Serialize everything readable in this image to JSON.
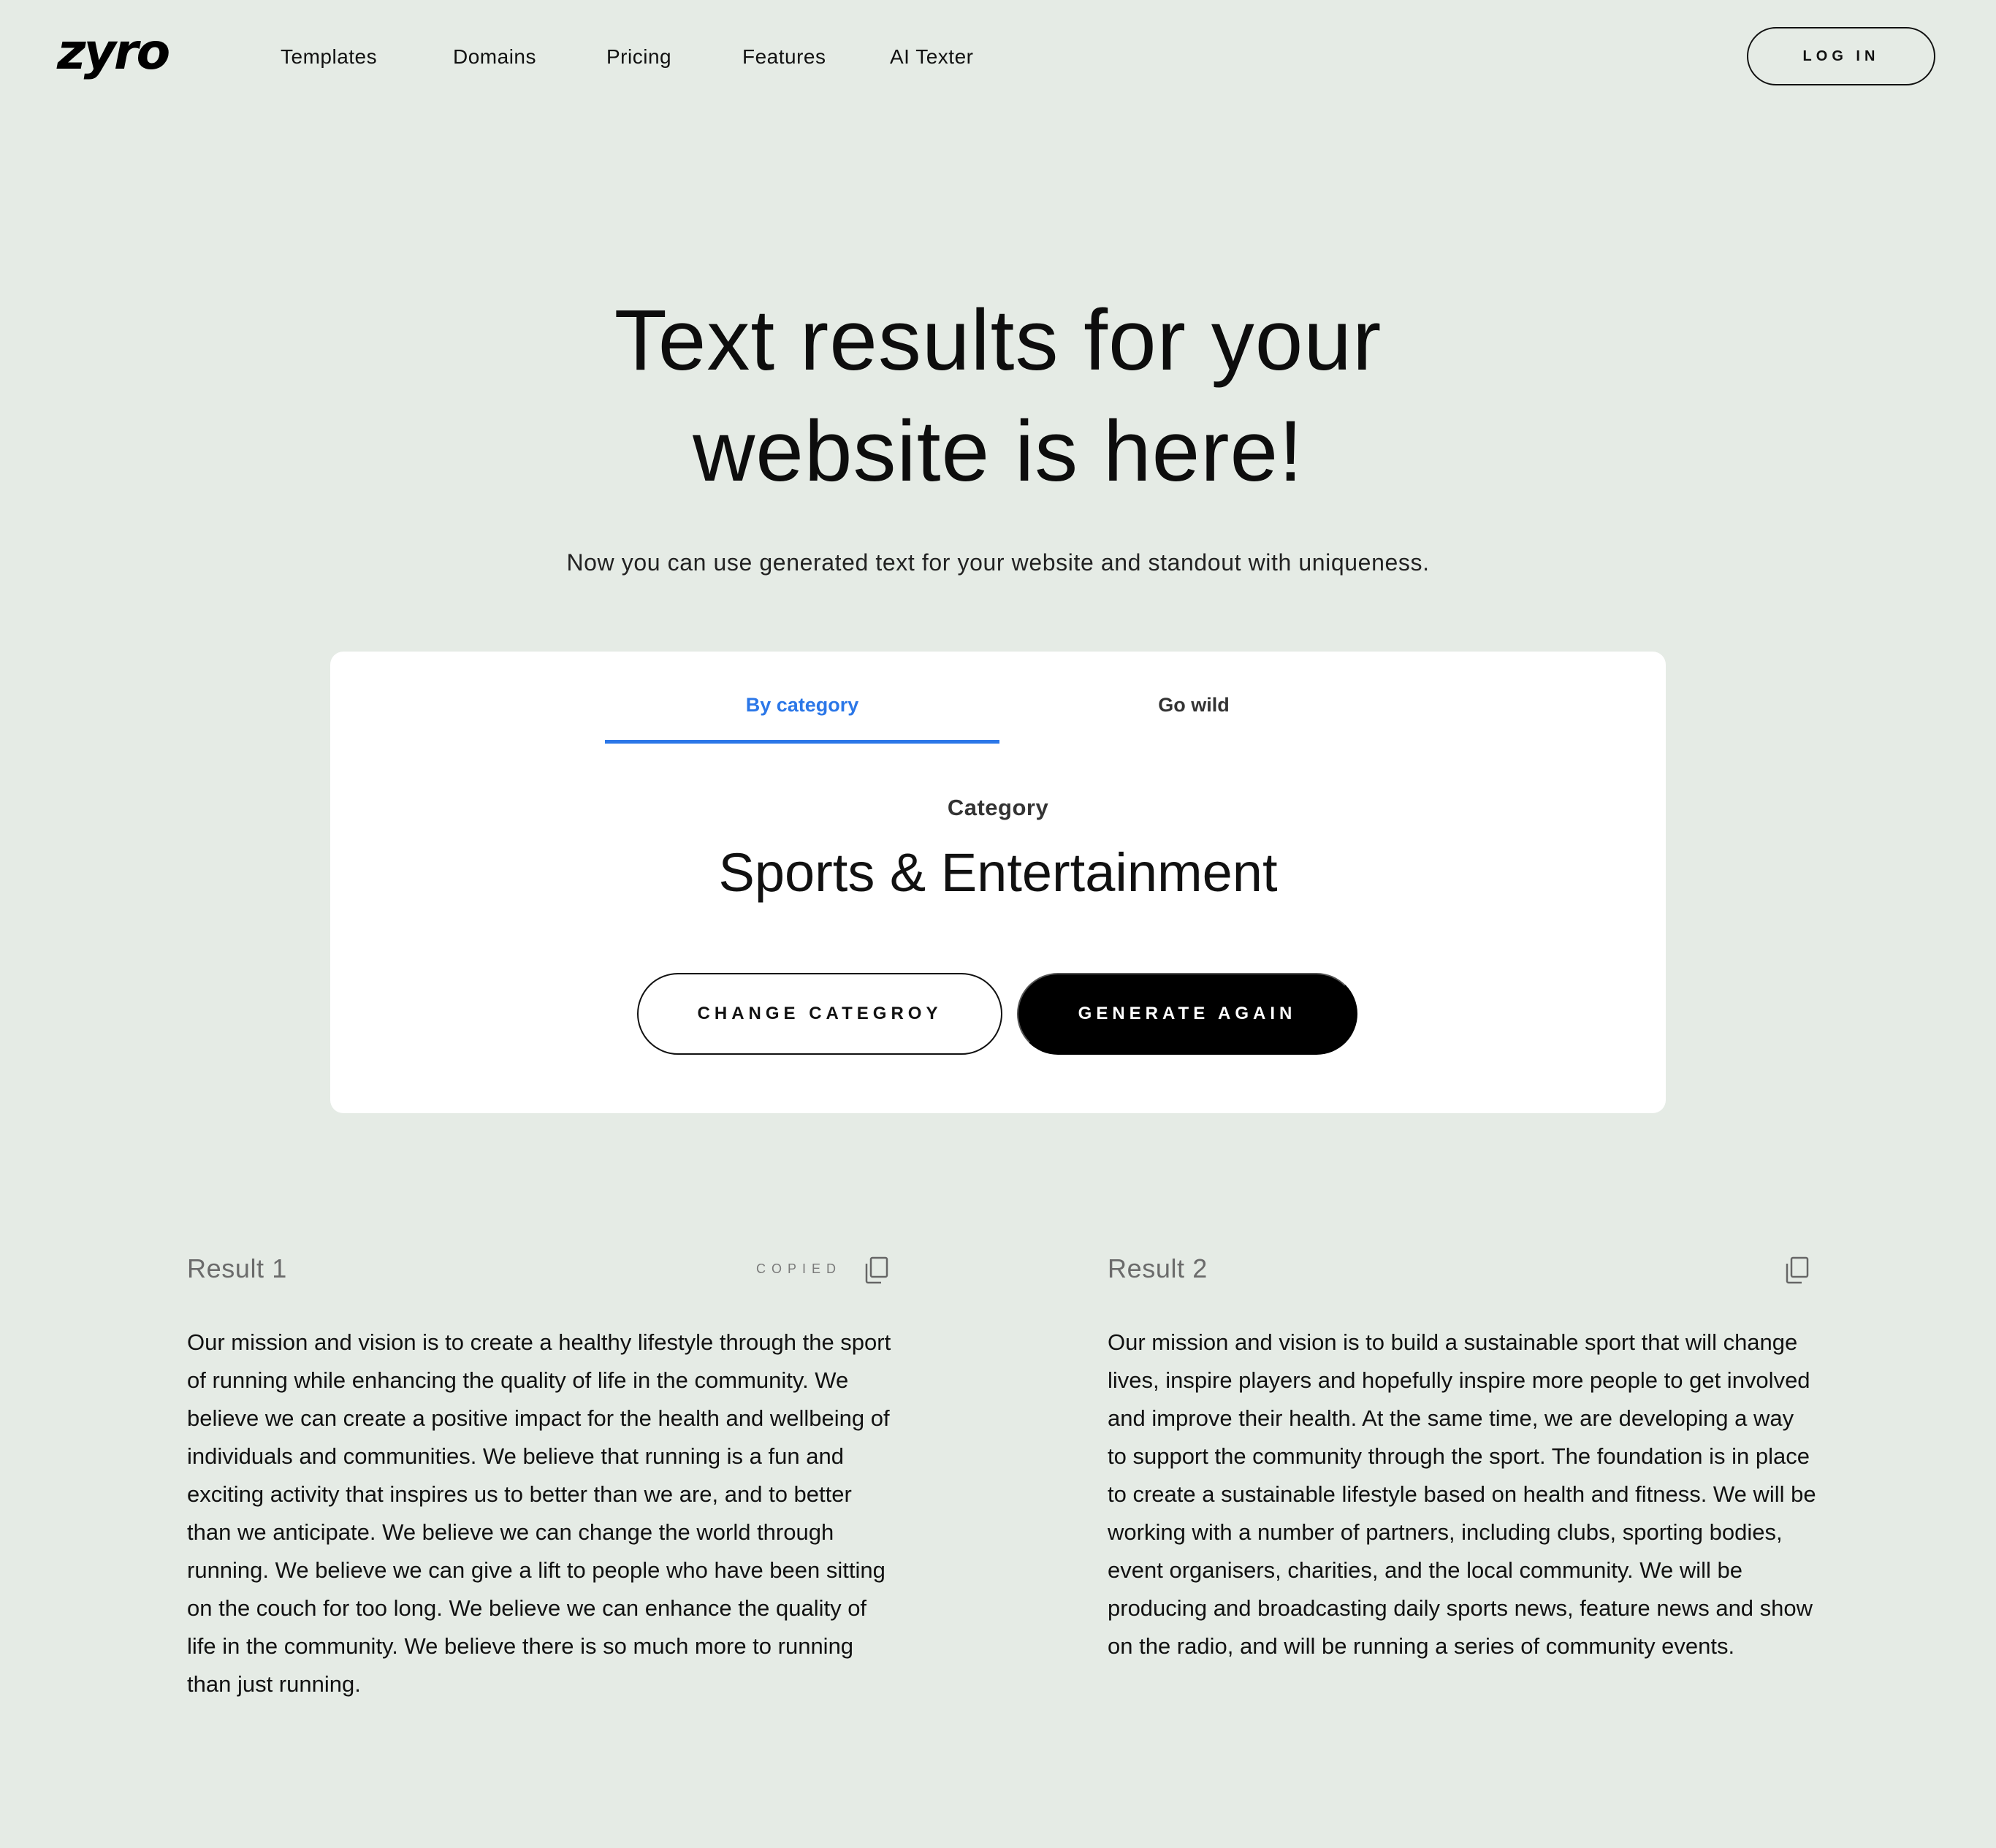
{
  "brand": {
    "logo": "zyro"
  },
  "nav": {
    "items": [
      "Templates",
      "Domains",
      "Pricing",
      "Features",
      "AI Texter"
    ]
  },
  "header": {
    "login_label": "LOG IN"
  },
  "hero": {
    "title_line1": "Text results for your",
    "title_line2": "website is here!",
    "subtitle": "Now you can use generated text for your website and standout with uniqueness."
  },
  "generator": {
    "tabs": [
      {
        "label": "By category",
        "active": true
      },
      {
        "label": "Go wild",
        "active": false
      }
    ],
    "category_label": "Category",
    "category_value": "Sports & Entertainment",
    "change_label": "CHANGE CATEGROY",
    "generate_label": "GENERATE AGAIN"
  },
  "results": [
    {
      "title": "Result 1",
      "status": "COPIED",
      "text": "Our mission and vision is to create a healthy lifestyle through the sport of running while enhancing the quality of life in the community. We believe we can create a positive impact for the health and wellbeing of individuals and communities. We believe that running is a fun and exciting activity that inspires us to better than we are, and to better than we anticipate. We believe we can change the world through running. We believe we can give a lift to people who have been sitting on the couch for too long. We believe we can enhance the quality of life in the community. We believe there is so much more to running than just running."
    },
    {
      "title": "Result 2",
      "status": "",
      "text": "Our mission and vision is to build a sustainable sport that will change lives, inspire players and hopefully inspire more people to get involved and improve their health. At the same time, we are developing a way to support the community through the sport. The foundation is in place to create a sustainable lifestyle based on health and fitness. We will be working with a number of partners, including clubs, sporting bodies, event organisers, charities, and the local community. We will be producing and broadcasting daily sports news, feature news and show on the radio, and will be running a series of community events."
    }
  ],
  "colors": {
    "background": "#e5ebe5",
    "accent": "#2b77e8",
    "card": "#ffffff",
    "primary_button": "#000000"
  },
  "icons": {
    "copy": "copy-icon"
  }
}
